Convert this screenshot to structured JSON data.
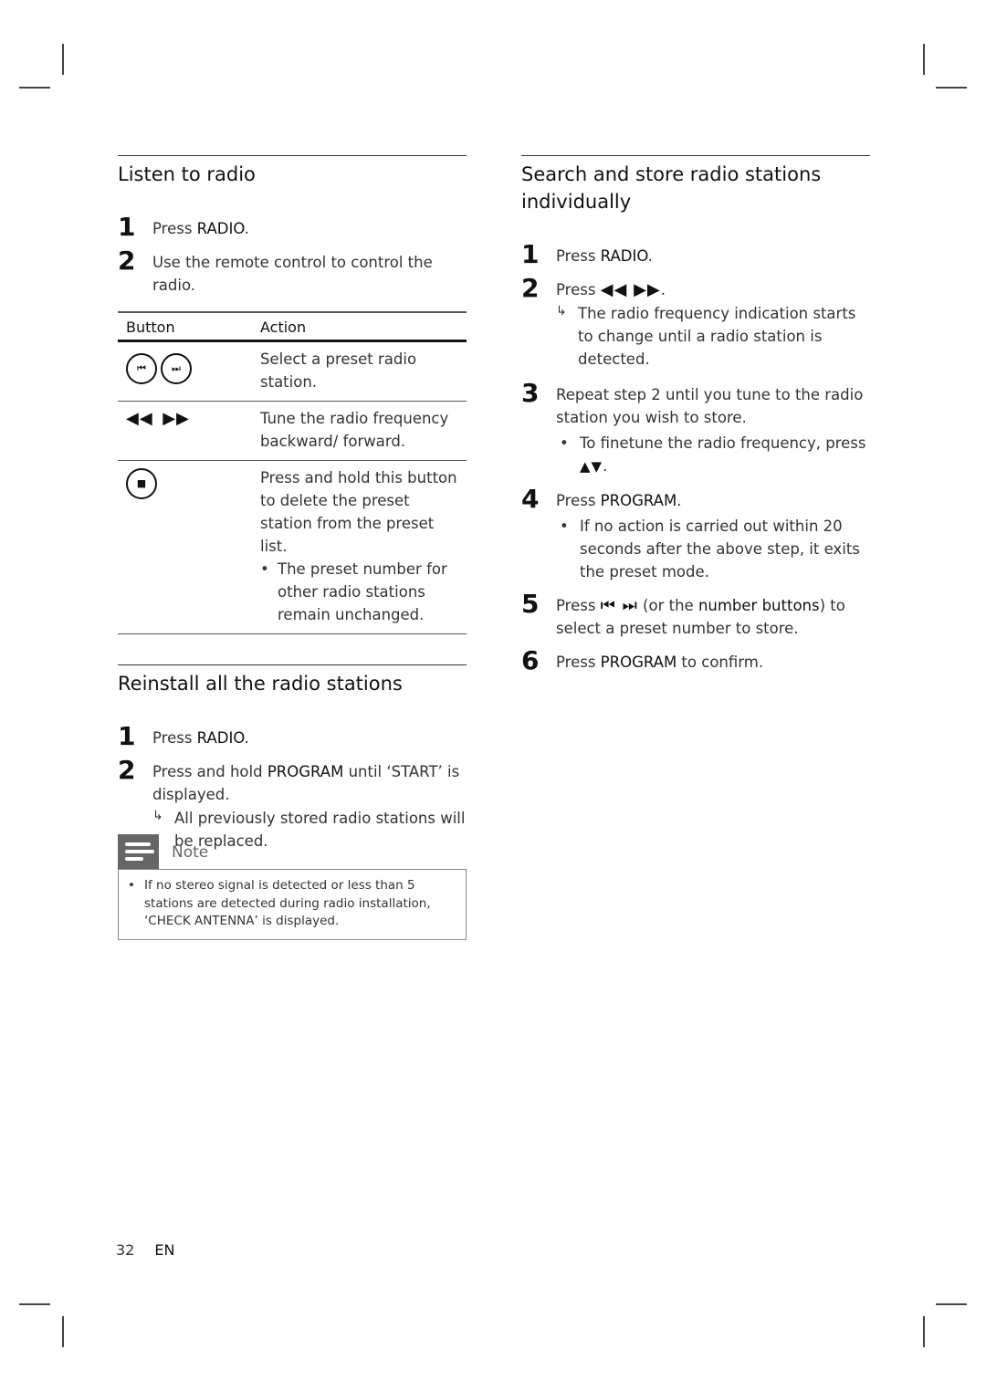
{
  "left_column": {
    "listen": {
      "title": "Listen to radio",
      "steps": [
        {
          "num": "1",
          "pre": "Press ",
          "kw": "RADIO",
          "post": "."
        },
        {
          "num": "2",
          "text": "Use the remote control to control the radio."
        }
      ],
      "table": {
        "headers": [
          "Button",
          "Action"
        ],
        "rows": [
          {
            "icons": [
              "previous-icon",
              "next-icon"
            ],
            "action": "Select a preset radio station."
          },
          {
            "icons": [
              "rewind-icon",
              "fast-forward-icon"
            ],
            "action": "Tune the radio frequency backward/ forward."
          },
          {
            "icons": [
              "stop-icon"
            ],
            "action": "Press and hold this button to delete the preset station from the preset list.",
            "bullet": "The preset number for other radio stations remain unchanged."
          }
        ]
      }
    },
    "reinstall": {
      "title": "Reinstall all the radio stations",
      "steps": [
        {
          "num": "1",
          "pre": "Press ",
          "kw": "RADIO",
          "post": "."
        },
        {
          "num": "2",
          "pre": "Press and hold ",
          "kw": "PROGRAM",
          "post": " until ‘START’ is displayed.",
          "result": "All previously stored radio stations will be replaced."
        }
      ]
    },
    "note": {
      "label": "Note",
      "text": "If no stereo signal is detected or less than 5 stations are detected during radio installation, ‘CHECK ANTENNA’ is displayed."
    }
  },
  "right_column": {
    "search": {
      "title": "Search and store radio stations individually",
      "steps": [
        {
          "num": "1",
          "pre": "Press ",
          "kw": "RADIO",
          "post": "."
        },
        {
          "num": "2",
          "pre": "Press ",
          "symbols": "◀◀ ▶▶",
          "post": ".",
          "result": "The radio frequency indication starts to change until a radio station is detected."
        },
        {
          "num": "3",
          "text": "Repeat step 2 until you tune to the radio station you wish to store.",
          "bullet_pre": "To finetune the radio frequency, press ",
          "bullet_symbols": "▲▼",
          "bullet_post": "."
        },
        {
          "num": "4",
          "pre": "Press ",
          "kw": "PROGRAM",
          "post": ".",
          "bullet": "If no action is carried out within 20 seconds after the above step, it exits the preset mode."
        },
        {
          "num": "5",
          "pre": "Press ",
          "symbols": "⏮ ⏭",
          "mid": " (or the ",
          "kw": "number buttons",
          "post": ") to select a preset number to store."
        },
        {
          "num": "6",
          "pre": "Press ",
          "kw": "PROGRAM",
          "post": " to confirm."
        }
      ]
    }
  },
  "footer": {
    "page_number": "32",
    "language": "EN"
  }
}
